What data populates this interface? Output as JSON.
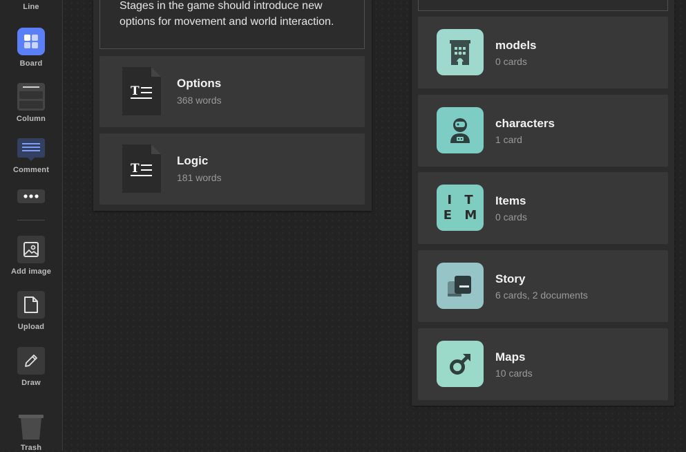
{
  "toolbar": {
    "items": [
      {
        "label": "Line",
        "icon": "line-icon"
      },
      {
        "label": "Board",
        "icon": "board-icon"
      },
      {
        "label": "Column",
        "icon": "column-icon"
      },
      {
        "label": "Comment",
        "icon": "comment-icon"
      },
      {
        "label": "",
        "icon": "more-icon"
      },
      {
        "label": "Add image",
        "icon": "image-icon"
      },
      {
        "label": "Upload",
        "icon": "upload-icon"
      },
      {
        "label": "Draw",
        "icon": "pencil-icon"
      },
      {
        "label": "Trash",
        "icon": "trash-icon"
      }
    ],
    "accent": "#5b7ff7"
  },
  "left_column": {
    "note": "Stages in the game should introduce new options for movement and world interaction.",
    "documents": [
      {
        "title": "Options",
        "subtitle": "368 words",
        "icon": "text-document-icon"
      },
      {
        "title": "Logic",
        "subtitle": "181 words",
        "icon": "text-document-icon"
      }
    ]
  },
  "right_column": {
    "boards": [
      {
        "title": "models",
        "subtitle": "0 cards",
        "icon": "building-icon",
        "color": "#9fd8cd"
      },
      {
        "title": "characters",
        "subtitle": "1 card",
        "icon": "astronaut-icon",
        "color": "#7ecdc5"
      },
      {
        "title": "Items",
        "subtitle": "0 cards",
        "icon_text": "I T\nE M",
        "icon": "item-text-icon",
        "color": "#7fccc0"
      },
      {
        "title": "Story",
        "subtitle": "6 cards, 2 documents",
        "icon": "books-icon",
        "color": "#97c4c7"
      },
      {
        "title": "Maps",
        "subtitle": "10 cards",
        "icon": "male-symbol-icon",
        "color": "#9bd9c8"
      }
    ]
  }
}
